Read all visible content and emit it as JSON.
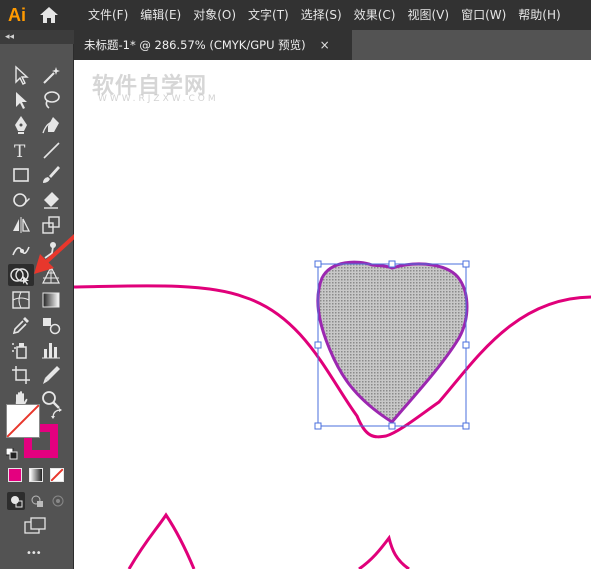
{
  "app": {
    "logo": "Ai",
    "home_icon": "home-icon"
  },
  "menu": {
    "items": [
      {
        "label": "文件(F)"
      },
      {
        "label": "编辑(E)"
      },
      {
        "label": "对象(O)"
      },
      {
        "label": "文字(T)"
      },
      {
        "label": "选择(S)"
      },
      {
        "label": "效果(C)"
      },
      {
        "label": "视图(V)"
      },
      {
        "label": "窗口(W)"
      },
      {
        "label": "帮助(H)"
      }
    ]
  },
  "tab": {
    "title": "未标题-1* @ 286.57% (CMYK/GPU 预览)",
    "close": "×"
  },
  "toolbar": {
    "collapse": "◂◂",
    "more": "•••",
    "fill_color": "#ffffff",
    "stroke_color": "#e4007f",
    "accent": "#e4007f",
    "selected_tool": "shape-builder-tool"
  },
  "canvas": {
    "watermark": "软件自学网",
    "watermark_sub": "WWW.RJZXW.COM",
    "stroke_color": "#e0007a",
    "selection_color": "#4a6fdc"
  }
}
